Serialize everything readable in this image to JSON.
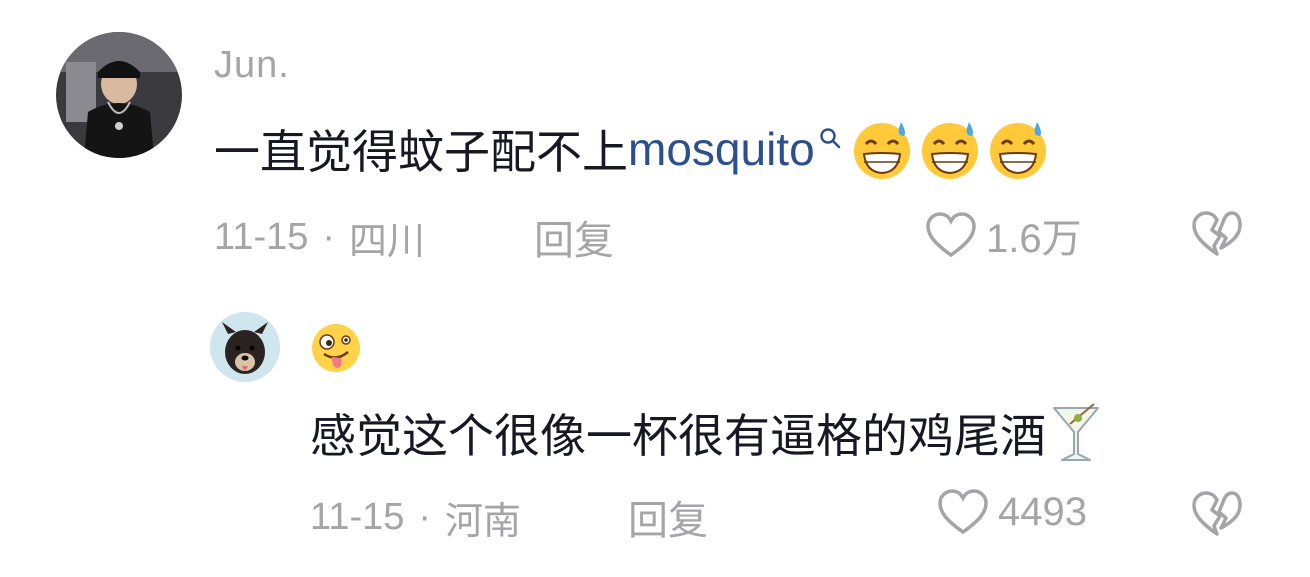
{
  "comments": [
    {
      "username": "Jun.",
      "text_before_link": "一直觉得蚊子配不上",
      "link_text": "mosquito",
      "trailing_emoji": [
        "sweat-grin-emoji",
        "sweat-grin-emoji",
        "sweat-grin-emoji"
      ],
      "date": "11-15",
      "separator": "·",
      "location": "四川",
      "reply_label": "回复",
      "like_count": "1.6万"
    },
    {
      "username_emoji": "zany-face-emoji",
      "text": "感觉这个很像一杯很有逼格的鸡尾酒",
      "trailing_emoji": [
        "cocktail-emoji"
      ],
      "date": "11-15",
      "separator": "·",
      "location": "河南",
      "reply_label": "回复",
      "like_count": "4493"
    }
  ],
  "colors": {
    "primary_text": "#161823",
    "secondary_text": "#a4a4a9",
    "link": "#2b4f8f",
    "background": "#ffffff"
  },
  "icons": {
    "like": "heart-outline-icon",
    "dislike": "broken-heart-icon",
    "search": "search-icon"
  }
}
